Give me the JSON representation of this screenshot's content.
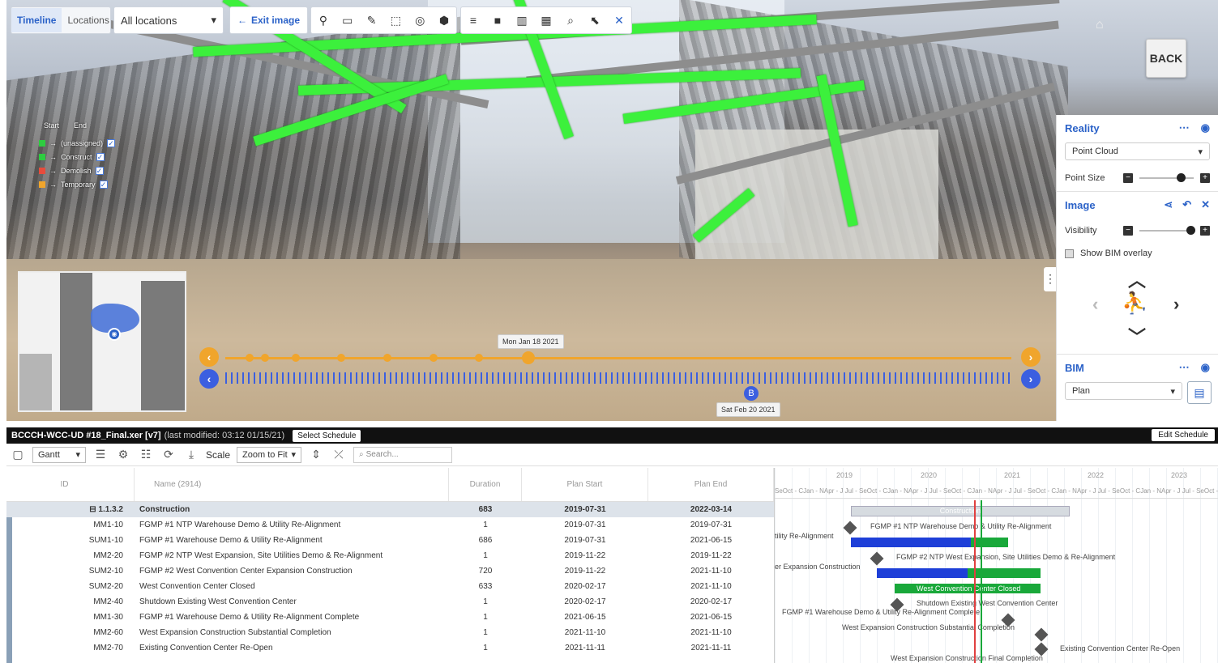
{
  "toolbar": {
    "tabs": [
      "Timeline",
      "Locations"
    ],
    "location": "All locations",
    "exit_label": "Exit image",
    "icons1": [
      "pin-icon",
      "ruler-icon",
      "pen-icon",
      "select-box-icon",
      "camera-icon",
      "cube-icon"
    ],
    "icons2": [
      "sort-icon",
      "briefcase-icon",
      "building-icon",
      "chart-icon",
      "zoom-icon",
      "cursor-select-icon",
      "close-icon"
    ]
  },
  "viewer": {
    "back_label": "BACK",
    "legend": {
      "head_start": "Start",
      "head_end": "End",
      "items": [
        {
          "label": "(unassigned)",
          "color": "#2ecc40"
        },
        {
          "label": "Construct",
          "color": "#2ecc40"
        },
        {
          "label": "Demolish",
          "color": "#e74c3c"
        },
        {
          "label": "Temporary",
          "color": "#f0a52c"
        }
      ]
    },
    "timeline": {
      "top_date": "Mon Jan 18 2021",
      "bottom_date": "Sat Feb 20 2021",
      "marker": "B"
    }
  },
  "panel": {
    "reality": {
      "title": "Reality",
      "mode": "Point Cloud",
      "point_size_label": "Point Size",
      "point_size_level": 0.78
    },
    "image": {
      "title": "Image",
      "visibility_label": "Visibility",
      "visibility_level": 0.95,
      "overlay_label": "Show BIM overlay"
    },
    "bim": {
      "title": "BIM",
      "mode": "Plan"
    }
  },
  "schedule": {
    "file": "BCCCH-WCC-UD #18_Final.xer [v7]",
    "modified": "(last modified: 03:12 01/15/21)",
    "select_label": "Select Schedule",
    "edit_label": "Edit Schedule",
    "view": "Gantt",
    "scale_label": "Scale",
    "scale_value": "Zoom to Fit",
    "search_placeholder": "Search...",
    "columns": {
      "id": "ID",
      "name": "Name (2914)",
      "duration": "Duration",
      "plan_start": "Plan Start",
      "plan_end": "Plan End"
    },
    "group": {
      "id": "1.1.3.2",
      "name": "Construction",
      "duration": "683",
      "start": "2019-07-31",
      "end": "2022-03-14"
    },
    "rows": [
      {
        "id": "MM1-10",
        "name": "FGMP #1 NTP Warehouse Demo & Utility Re-Alignment",
        "duration": "1",
        "start": "2019-07-31",
        "end": "2019-07-31"
      },
      {
        "id": "SUM1-10",
        "name": "FGMP #1 Warehouse Demo & Utility Re-Alignment",
        "duration": "686",
        "start": "2019-07-31",
        "end": "2021-06-15"
      },
      {
        "id": "MM2-20",
        "name": "FGMP #2 NTP West Expansion, Site Utilities Demo & Re-Alignment",
        "duration": "1",
        "start": "2019-11-22",
        "end": "2019-11-22"
      },
      {
        "id": "SUM2-10",
        "name": "FGMP #2 West Convention Center Expansion Construction",
        "duration": "720",
        "start": "2019-11-22",
        "end": "2021-11-10"
      },
      {
        "id": "SUM2-20",
        "name": "West Convention Center Closed",
        "duration": "633",
        "start": "2020-02-17",
        "end": "2021-11-10"
      },
      {
        "id": "MM2-40",
        "name": "Shutdown Existing West Convention Center",
        "duration": "1",
        "start": "2020-02-17",
        "end": "2020-02-17"
      },
      {
        "id": "MM1-30",
        "name": "FGMP #1 Warehouse Demo & Utility Re-Alignment Complete",
        "duration": "1",
        "start": "2021-06-15",
        "end": "2021-06-15"
      },
      {
        "id": "MM2-60",
        "name": "West Expansion Construction Substantial Completion",
        "duration": "1",
        "start": "2021-11-10",
        "end": "2021-11-10"
      },
      {
        "id": "MM2-70",
        "name": "Existing Convention Center Re-Open",
        "duration": "1",
        "start": "2021-11-11",
        "end": "2021-11-11"
      }
    ]
  },
  "gantt": {
    "years": [
      "2019",
      "2020",
      "2021",
      "2022",
      "2023"
    ],
    "months": "SeOct - CJan - NApr - J Jul - SeOct - CJan - NApr - J Jul - SeOct - CJan - NApr - J Jul - SeOct - CJan - NApr - J Jul - SeOct - CJan - NApr - J Jul - SeOct - C",
    "group_label": "Construction",
    "labels": {
      "l1": "FGMP #1 NTP Warehouse Demo & Utility Re-Alignment",
      "l2": "tility Re-Alignment",
      "l3": "FGMP #2 NTP West Expansion, Site Utilities Demo & Re-Alignment",
      "l4": "er Expansion Construction",
      "l5": "West Convention Center Closed",
      "l6": "Shutdown Existing West Convention Center",
      "l7": "FGMP #1 Warehouse Demo & Utility Re-Alignment Complete",
      "l8": "West Expansion Construction Substantial Completion",
      "l9": "Existing Convention Center Re-Open",
      "l10": "West Expansion Construction Final Completion"
    }
  }
}
